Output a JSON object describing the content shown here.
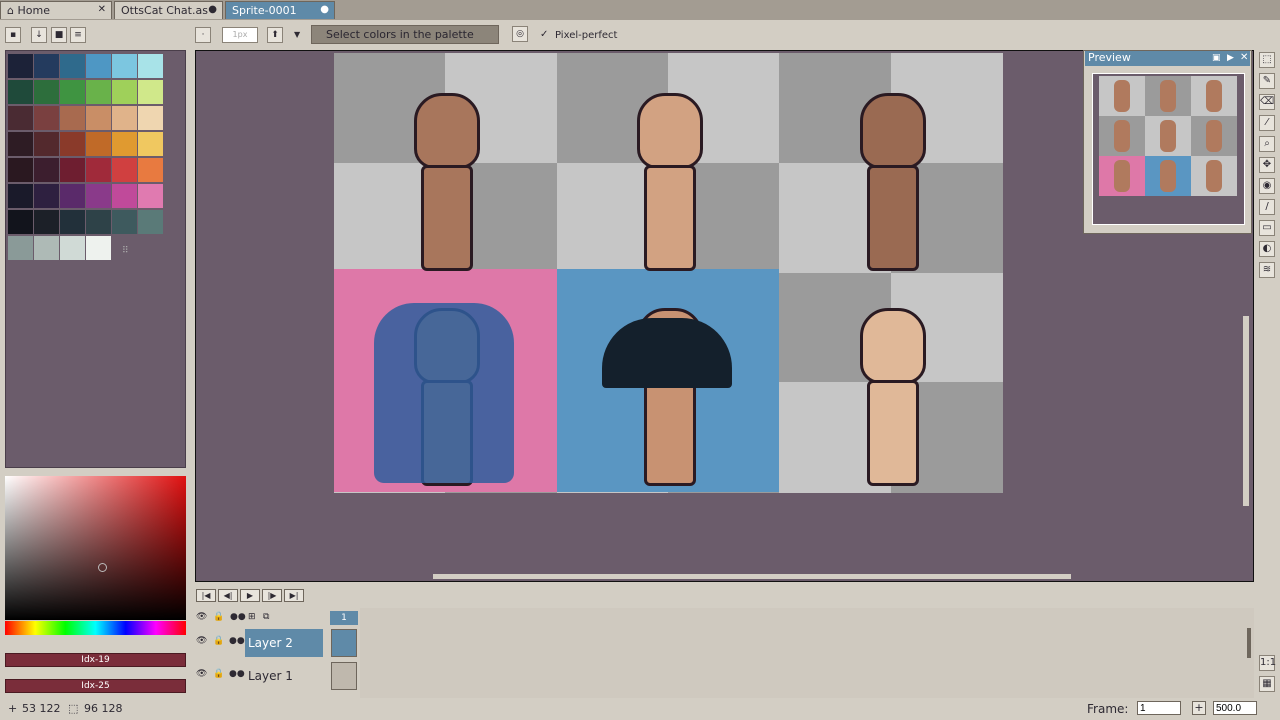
{
  "tabs": [
    {
      "label": "Home",
      "close": "✕"
    },
    {
      "label": "OttsCat Chat.as",
      "close": "●"
    },
    {
      "label": "Sprite-0001",
      "close": "●"
    }
  ],
  "context_bar": {
    "brush_size": "1px",
    "hint": "Select colors in the palette",
    "pixel_perfect_label": "Pixel-perfect",
    "pixel_perfect_checked": true
  },
  "palette": {
    "colors": [
      "#1c2238",
      "#243b5e",
      "#2f6a8c",
      "#4e97c4",
      "#7cc6e0",
      "#a8e3e8",
      "#1f4a3a",
      "#2d6e3c",
      "#3f9441",
      "#69b24a",
      "#9fd05a",
      "#d0e88a",
      "#4a2b33",
      "#7a4040",
      "#a86a4f",
      "#c98e66",
      "#e0b38a",
      "#efd6b0",
      "#2e1c24",
      "#53292d",
      "#8a3a2a",
      "#c06a28",
      "#e09a30",
      "#f0c860",
      "#2a1820",
      "#3c1e2e",
      "#6e1e30",
      "#a02a3a",
      "#d04040",
      "#e87a40",
      "#1a1a2a",
      "#2e2040",
      "#5a2a6a",
      "#8a3a8a",
      "#c04a9a",
      "#e07ab0",
      "#12141c",
      "#1c2028",
      "#22303a",
      "#2e4248",
      "#3e5a5e",
      "#5a7a78",
      "#8a9a98",
      "#aebab6",
      "#d0dad6",
      "#eef2ee"
    ]
  },
  "color_picker": {
    "fg_index": "Idx-19",
    "bg_index": "Idx-25"
  },
  "preview": {
    "title": "Preview"
  },
  "timeline": {
    "frame_number": "1",
    "layers": [
      {
        "name": "Layer 2",
        "selected": true
      },
      {
        "name": "Layer 1",
        "selected": false
      }
    ]
  },
  "status": {
    "cursor_pos": "53 122",
    "selection_size": "96 128",
    "frame_label": "Frame:",
    "frame_value": "1",
    "zoom_value": "500.0"
  }
}
